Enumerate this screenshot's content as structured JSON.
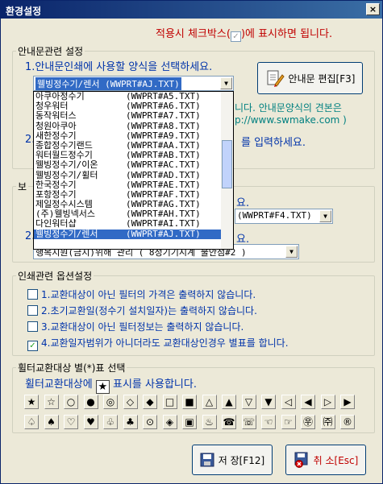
{
  "window": {
    "title": "환경설정",
    "close": "×"
  },
  "hint": {
    "prefix": "적용시 체크박스(",
    "check": "✓",
    "suffix": ")에 표시하면 됩니다."
  },
  "guide_section": {
    "legend": "안내문관련 설정",
    "step1": "1.안내문인쇄에 사용할 양식을 선택하세요.",
    "combo_value": "웰빙정수기/렌서 (WWPRT#AJ.TXT)",
    "edit_button": "안내문 편집[F3]",
    "partial_note": "니다. 안내문양식의 견본은",
    "partial_url": "p://www.swmake.com )",
    "step2_partial": "2.",
    "step2_suffix": "를 입력하세요."
  },
  "dropdown": {
    "items": [
      {
        "name": "아쿠아정수기",
        "file": "(WWPRT#A5.TXT)"
      },
      {
        "name": "청우워터",
        "file": "(WWPRT#A6.TXT)"
      },
      {
        "name": "동작워터스",
        "file": "(WWPRT#A7.TXT)"
      },
      {
        "name": "청원아쿠아",
        "file": "(WWPRT#A8.TXT)"
      },
      {
        "name": "새한정수기",
        "file": "(WWPRT#A9.TXT)"
      },
      {
        "name": "종합정수기랜드",
        "file": "(WWPRT#AA.TXT)"
      },
      {
        "name": "워터월드정수기",
        "file": "(WWPRT#AB.TXT)"
      },
      {
        "name": "웰빙정수기/이온",
        "file": "(WWPRT#AC.TXT)"
      },
      {
        "name": "웰빙정수기/휠터",
        "file": "(WWPRT#AD.TXT)"
      },
      {
        "name": "한국정수기",
        "file": "(WWPRT#AE.TXT)"
      },
      {
        "name": "포항정수기",
        "file": "(WWPRT#AF.TXT)"
      },
      {
        "name": "제일정수시스템",
        "file": "(WWPRT#AG.TXT)"
      },
      {
        "name": "(주)웰빙넥서스",
        "file": "(WWPRT#AH.TXT)"
      },
      {
        "name": "다인워터샵",
        "file": "(WWPRT#AI.TXT)"
      },
      {
        "name": "웰빙정수기/렌서",
        "file": "(WWPRT#AJ.TXT)"
      }
    ]
  },
  "report_section": {
    "legend_partial": "보",
    "step1_suffix": "요.",
    "combo1_value": "(WWPRT#F4.TXT)",
    "step2_prefix": "2.",
    "step2_suffix": "요.",
    "combo2_value": "행복지원(금지)위해 관리 ( 8정기기시계 불안점#2 )"
  },
  "print_section": {
    "legend": "인쇄관련 옵션설정",
    "options": [
      {
        "label": "1.교환대상이 아닌 필터의 가격은 출력하지 않습니다.",
        "checked": false
      },
      {
        "label": "2.초기교환일(정수기 설치일자)는 출력하지 않습니다.",
        "checked": false
      },
      {
        "label": "3.교환대상이 아닌 필터정보는 출력하지 않습니다.",
        "checked": false
      },
      {
        "label": "4.교환일자범위가 아니더라도 교환대상인경우 별표를 합니다.",
        "checked": true
      }
    ]
  },
  "symbol_section": {
    "legend": "휠터교환대상 별(*)표 선택",
    "caption_prefix": "휠터교환대상에",
    "selected_symbol": "★",
    "caption_suffix": "표시를 사용합니다.",
    "row1": [
      "★",
      "☆",
      "○",
      "●",
      "◎",
      "◇",
      "◆",
      "□",
      "■",
      "△",
      "▲",
      "▽",
      "▼",
      "◁",
      "◀",
      "▷",
      "▶"
    ],
    "row2": [
      "♤",
      "♠",
      "♡",
      "♥",
      "♧",
      "♣",
      "⊙",
      "◈",
      "▣",
      "♨",
      "☎",
      "☏",
      "☜",
      "☞",
      "㉾",
      "㈜",
      "®"
    ]
  },
  "buttons": {
    "save": "저 장[F12]",
    "cancel": "취 소[Esc]"
  }
}
